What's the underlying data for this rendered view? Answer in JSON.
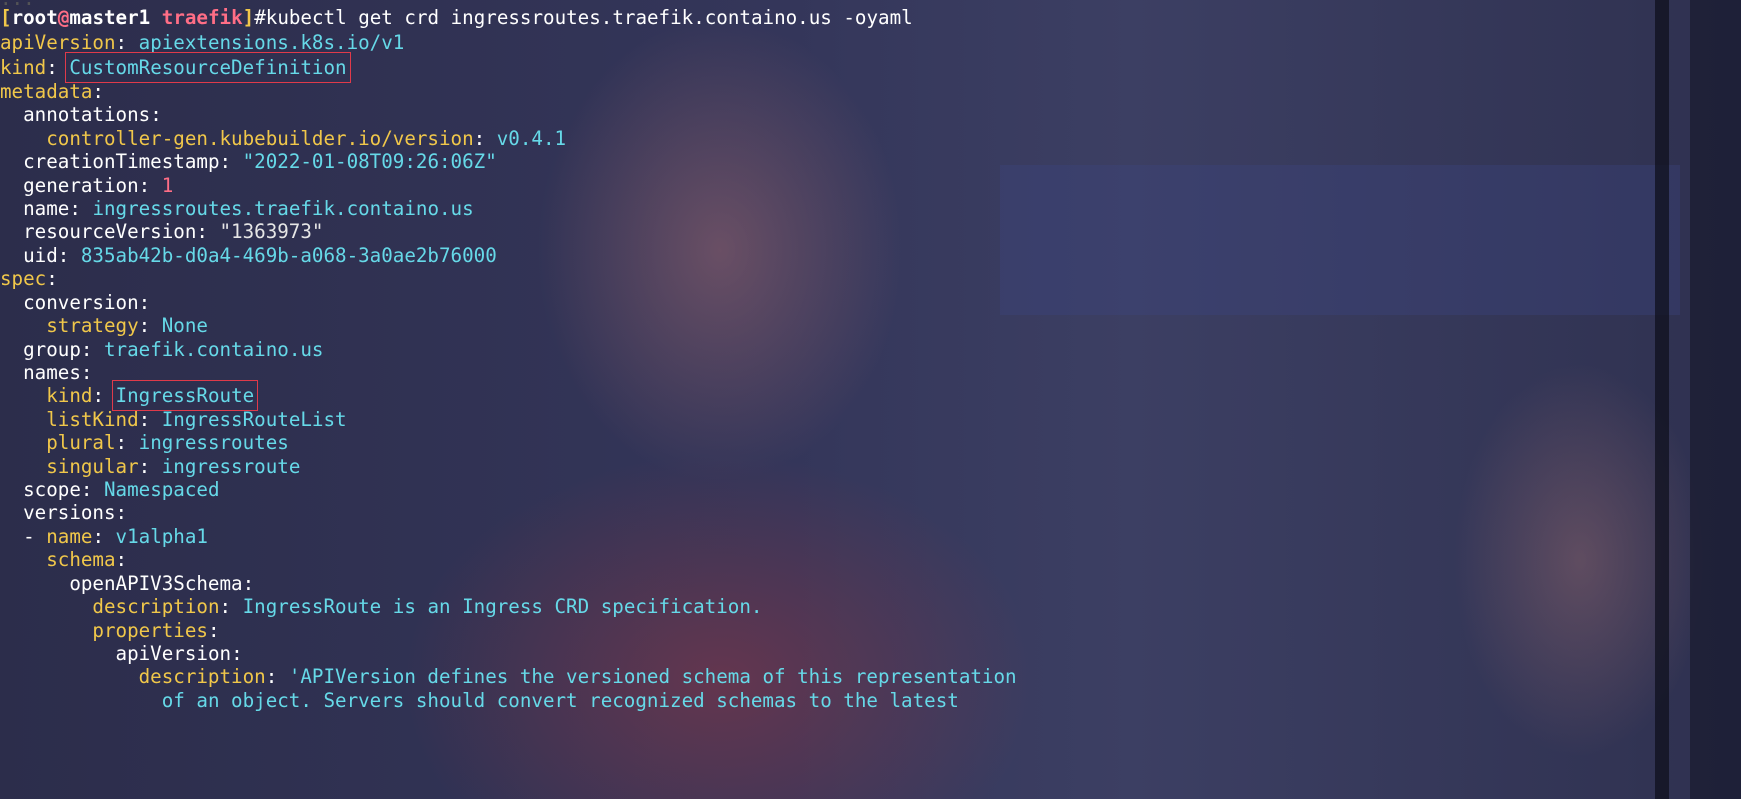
{
  "top_partial_line": "...",
  "prompt": {
    "user": "root",
    "at": "@",
    "host": "master1",
    "dir": "traefik",
    "symbol": "#",
    "command": "kubectl get crd ingressroutes.traefik.containo.us -oyaml"
  },
  "yaml": {
    "apiVersion_key": "apiVersion",
    "apiVersion_val": "apiextensions.k8s.io/v1",
    "kind_key": "kind",
    "kind_val": "CustomResourceDefinition",
    "metadata_key": "metadata",
    "annotations_key": "annotations",
    "controller_gen_key": "controller-gen.kubebuilder.io/version",
    "controller_gen_val": "v0.4.1",
    "creation_key": "creationTimestamp",
    "creation_val": "\"2022-01-08T09:26:06Z\"",
    "generation_key": "generation",
    "generation_val": "1",
    "name_key": "name",
    "name_val": "ingressroutes.traefik.containo.us",
    "resource_key": "resourceVersion",
    "resource_val": "\"1363973\"",
    "uid_key": "uid",
    "uid_val": "835ab42b-d0a4-469b-a068-3a0ae2b76000",
    "spec_key": "spec",
    "conversion_key": "conversion",
    "strategy_key": "strategy",
    "strategy_val": "None",
    "group_key": "group",
    "group_val": "traefik.containo.us",
    "names_key": "names",
    "names_kind_key": "kind",
    "names_kind_val": "IngressRoute",
    "listkind_key": "listKind",
    "listkind_val": "IngressRouteList",
    "plural_key": "plural",
    "plural_val": "ingressroutes",
    "singular_key": "singular",
    "singular_val": "ingressroute",
    "scope_key": "scope",
    "scope_val": "Namespaced",
    "versions_key": "versions",
    "vname_dash": "- ",
    "vname_key": "name",
    "vname_val": "v1alpha1",
    "schema_key": "schema",
    "openapi_key": "openAPIV3Schema",
    "description_key": "description",
    "description_val": "IngressRoute is an Ingress CRD specification.",
    "properties_key": "properties",
    "apiversion2_key": "apiVersion",
    "desc2_key": "description",
    "desc2_val": "'APIVersion defines the versioned schema of this representation",
    "desc2_cont": "of an object. Servers should convert recognized schemas to the latest"
  },
  "colors": {
    "background": "#2b2d4a",
    "key_yellow": "#f0c74a",
    "value_cyan": "#66d9e8",
    "number_pink": "#ff6e86",
    "highlight_box": "#e03a4a"
  }
}
